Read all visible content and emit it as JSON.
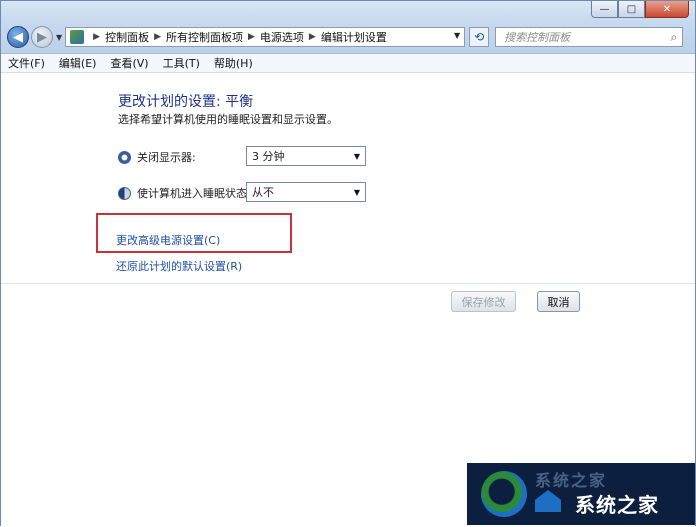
{
  "window": {
    "buttons": {
      "minimize": "—",
      "maximize": "□",
      "close": "✕"
    }
  },
  "nav": {
    "back_icon": "◀",
    "forward_icon": "▶",
    "breadcrumb": [
      "控制面板",
      "所有控制面板项",
      "电源选项",
      "编辑计划设置"
    ],
    "search_placeholder": "搜索控制面板"
  },
  "menu": [
    "文件(F)",
    "编辑(E)",
    "查看(V)",
    "工具(T)",
    "帮助(H)"
  ],
  "main": {
    "title": "更改计划的设置: 平衡",
    "subtitle": "选择希望计算机使用的睡眠设置和显示设置。",
    "display_label": "关闭显示器:",
    "display_value": "3 分钟",
    "sleep_label": "使计算机进入睡眠状态:",
    "sleep_value": "从不",
    "advanced_link": "更改高级电源设置(C)",
    "restore_link": "还原此计划的默认设置(R)",
    "save_label": "保存修改",
    "cancel_label": "取消"
  },
  "watermark": {
    "top": "系统之家",
    "text": "系统之家"
  },
  "colors": {
    "title": "#1e3287",
    "link": "#1e4fa8",
    "highlight": "#c8323c"
  }
}
